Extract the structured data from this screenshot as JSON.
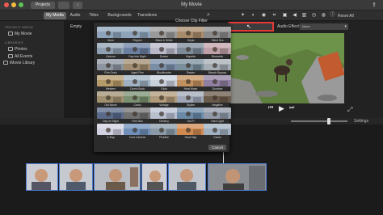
{
  "window": {
    "title": "My Movie",
    "projects_label": "Projects",
    "import_icon": "import-arrow-icon",
    "share_icon": "share-icon"
  },
  "toolbar": {
    "tabs": [
      {
        "label": "My Media",
        "active": true
      },
      {
        "label": "Audio",
        "active": false
      },
      {
        "label": "Titles",
        "active": false
      },
      {
        "label": "Backgrounds",
        "active": false
      },
      {
        "label": "Transitions",
        "active": false
      }
    ],
    "reset_all": "Reset All",
    "tool_icons": [
      "wand-icon",
      "color-balance-icon",
      "color-correction-icon",
      "crop-icon",
      "stabilization-icon",
      "volume-icon",
      "noise-reduction-icon",
      "speed-icon",
      "filter-icon",
      "info-icon"
    ]
  },
  "sidebar": {
    "project_media_heading": "PROJECT MEDIA",
    "project_item": "My Movie",
    "libraries_heading": "LIBRARIES",
    "library_items": [
      "Photos",
      "All Events",
      "iMovie Library"
    ]
  },
  "browser": {
    "label": "Empty"
  },
  "viewer": {
    "audio_effect_label": "Audio Effect:",
    "audio_effect_value": "None",
    "settings_label": "Settings"
  },
  "dialog": {
    "title": "Choose Clip Filter",
    "cancel_label": "Cancel",
    "filters": [
      "None",
      "Flipped",
      "Black & White",
      "Sepia",
      "Silent Era",
      "Cartoon",
      "Day Into Night",
      "Dream",
      "Vignette",
      "Romantic",
      "Film Grain",
      "Aged Film",
      "Blockbuster",
      "Raster",
      "Bleach Bypass",
      "Western",
      "Comic Book",
      "Glow",
      "Heat Wave",
      "Duotone",
      "Old Movie",
      "Camo",
      "Vintage",
      "Stylize",
      "Negative",
      "Day for Night",
      "Film Noir",
      "Dreamy",
      "Sci-Fi",
      "Hard Light",
      "X-Ray",
      "Cool Camera",
      "Pixelize",
      "Heat Map",
      "Comic"
    ]
  }
}
